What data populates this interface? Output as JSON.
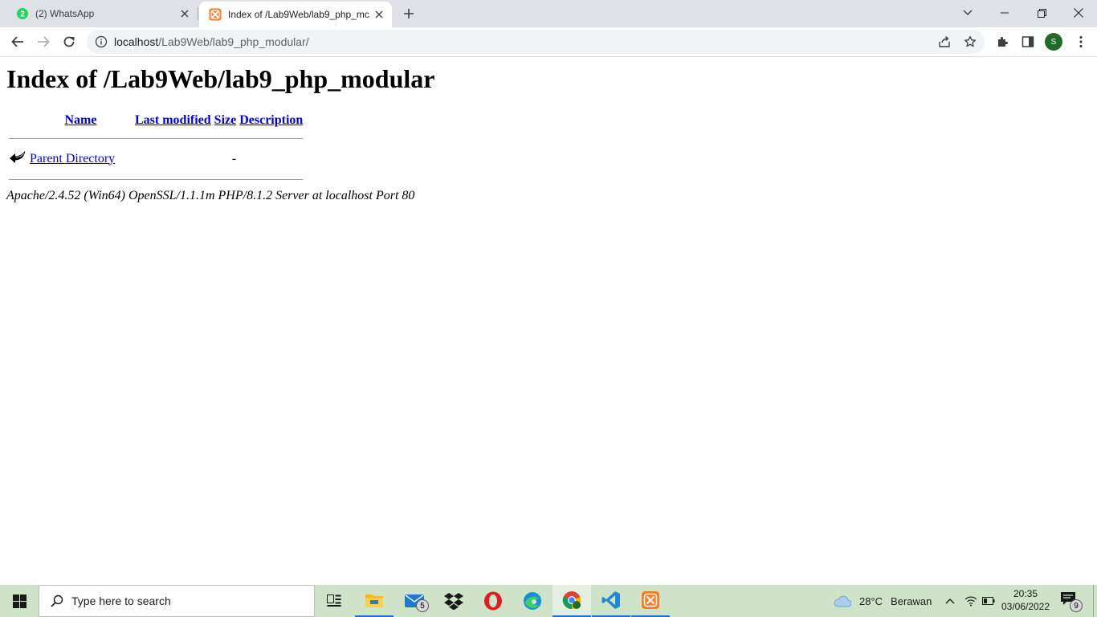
{
  "browser": {
    "tabs": [
      {
        "title": "(2) WhatsApp",
        "favicon_badge": "2",
        "favicon": "whatsapp-icon",
        "active": false
      },
      {
        "title": "Index of /Lab9Web/lab9_php_mc",
        "favicon": "xampp-icon",
        "active": true
      }
    ],
    "address": {
      "host": "localhost",
      "path": "/Lab9Web/lab9_php_modular/"
    },
    "profile_initial": "S",
    "colors": {
      "tabstrip": "#dee1e6",
      "omnibox": "#f1f3f4",
      "avatar": "#1e6b2a"
    }
  },
  "page": {
    "heading": "Index of /Lab9Web/lab9_php_modular",
    "columns": {
      "name": "Name",
      "last_modified": "Last modified",
      "size": "Size",
      "description": "Description"
    },
    "rows": [
      {
        "name": "Parent Directory",
        "last_modified": "",
        "size": "-",
        "description": "",
        "icon": "back-arrow-icon"
      }
    ],
    "server_signature": "Apache/2.4.52 (Win64) OpenSSL/1.1.1m PHP/8.1.2 Server at localhost Port 80",
    "colors": {
      "link": "#0000ee"
    }
  },
  "taskbar": {
    "search_placeholder": "Type here to search",
    "apps": [
      {
        "name": "task-view-icon"
      },
      {
        "name": "file-explorer-icon"
      },
      {
        "name": "mail-icon",
        "badge": "5"
      },
      {
        "name": "dropbox-icon"
      },
      {
        "name": "opera-icon"
      },
      {
        "name": "edge-icon"
      },
      {
        "name": "chrome-icon",
        "active": true
      },
      {
        "name": "vscode-icon",
        "active": true
      },
      {
        "name": "xampp-icon",
        "active": true
      }
    ],
    "weather": {
      "temp": "28°C",
      "condition": "Berawan"
    },
    "clock": {
      "time": "20:35",
      "date": "03/06/2022"
    },
    "notifications_badge": "9",
    "colors": {
      "background": "#cfe3c9"
    }
  }
}
